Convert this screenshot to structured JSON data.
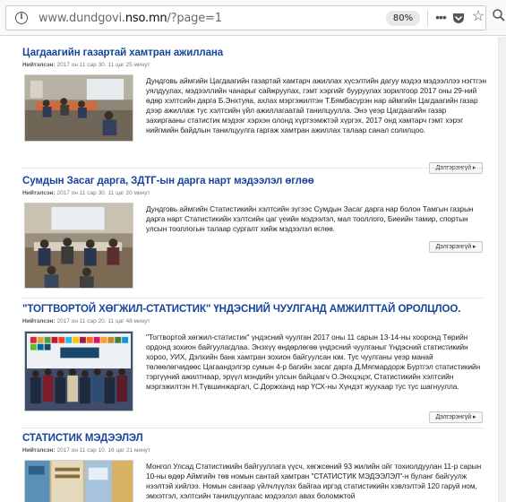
{
  "browser": {
    "url_prefix": "www.dundgovi.",
    "url_domain": "nso.mn",
    "url_suffix": "/?page=1",
    "zoom": "80%"
  },
  "read_more_label": "Дэлгэрэнгүй ▸",
  "posted_label": "Нийтэлсэн:",
  "articles": [
    {
      "title": "Цагдаагийн газартай хамтран ажиллана",
      "date": "2017 он 11 сар 30. 11 цаг 25 минут",
      "body": "Дундговь аймгийн Цагдаагийн газартай хамтарч ажиллах хүсэлтийн дагуу мэдээ мэдээллээ нэгтгэн уялдуулах, мэдээллийн чанарыг сайжруулах, гэмт хэргийг бууруулах зорилгоор 2017 оны 29-ний өдөр хэлтсийн дарга Б.Энхтуяа, ахлах мэргэжилтэн Т.Бямбасүрэн нар аймгийн Цагдаагийн газар дээр ажиллаж тус хэлтсийн үйл ажиллагаатай танилцуулла. Энэ үеэр Цагдаагийн газар захиргааны статистик мэдээг хэрхэн олонд хүртээмжтэй хүргэх, 2017 онд хамтарч гэмт хэрэг нийгмийн байдлын танилцуулга гаргаж хамтран ажиллах талаар санал солилцоо."
    },
    {
      "title": "Сумдын Засаг дарга, ЗДТГ-ын дарга нарт мэдээлэл өглөө",
      "date": "2017 он 11 сар 30. 11 цаг 20 минут",
      "body": "Дундговь аймгийн Статистикийн хэлтсийн зүгээс Сумдын Засаг дарга нар болон Тамгын газрын дарга нарт Статистикийн хэлтсийн цаг үеийн мэдээлэл, мал тооллого, Биеийн тамир, спортын улсын тооллогын талаар сургалт хийж мэдээлэл өглөө."
    },
    {
      "title": "\"ТОГТВОРТОЙ ХӨГЖИЛ-СТАТИСТИК\" ҮНДЭСНИЙ ЧУУЛГАНД АМЖИЛТТАЙ ОРОЛЦЛОО.",
      "date": "2017 он 11 сар 20. 11 цаг 48 минут",
      "body": "\"Тогтвортой хөгжил-статистик\" үндэсний чуулган 2017 оны 11 сарын 13-14-ны хооронд Төрийн ордонд зохион байгуулагдлаа. Энэхүү өндөрлөгөө үндэсний чуулганыг Үндэсний статистикийн хороо, УИХ, Дэлхийн банк хамтран зохион байгуулсан юм. Тус чуулганы үеэр манай төлөөлөгчидөөс Цагаандэлгэр сумын 4-р багийн засаг дарга Д.Мягмардорж Бүртгэл статистикийн тэргүүний ажилтнаар, эрүүл мэндийн улсын байцаагч О.Энхцэцэг, Статистикийн хэлтсийн мэргэжилтэн Н.Түвшинжаргал, С.Доржханд нар ҮСХ-ны Хүндэт жуухаар тус тус шагнуулла."
    },
    {
      "title": "СТАТИСТИК МЭДЭЭЛЭЛ",
      "date": "2017 он 11 сар 10. 16 цаг 21 минут",
      "body": "Монгол Улсад Статистикийн байгууллага үүсч, хөгжсөний 93 жилийн ойг тохиолдуулан 11-р сарын 10-ны өдөр Аймгийн төв номын сантай хамтран \"СТАТИСТИК МЭДЭЭЛЭЛ\"-н буланг байгуулж нээлтэй хийлээ. Номын сангаар үйлчлүүлэх байгаа иргэд статистикийн хэвлэлтэй 120 гаруй ном, эмхэтгэл, хэлтсийн танилцуулгаас мэдээлэл авах боломжтой"
    }
  ]
}
